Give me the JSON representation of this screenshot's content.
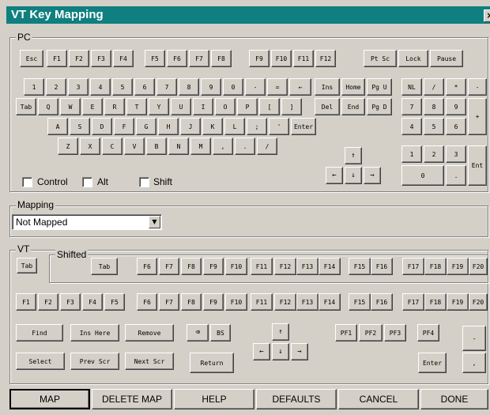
{
  "window": {
    "title": "VT Key Mapping",
    "close_glyph": "×"
  },
  "pc": {
    "group_label": "PC",
    "keys": {
      "esc": "Esc",
      "f1": "F1",
      "f2": "F2",
      "f3": "F3",
      "f4": "F4",
      "f5": "F5",
      "f6": "F6",
      "f7": "F7",
      "f8": "F8",
      "f9": "F9",
      "f10": "F10",
      "f11": "F11",
      "f12": "F12",
      "ptsc": "Pt Sc",
      "lock": "Lock",
      "pause": "Pause",
      "n1": "1",
      "n2": "2",
      "n3": "3",
      "n4": "4",
      "n5": "5",
      "n6": "6",
      "n7": "7",
      "n8": "8",
      "n9": "9",
      "n0": "0",
      "minus": "-",
      "equals": "=",
      "bksp": "←",
      "ins": "Ins",
      "home": "Home",
      "pgu": "Pg U",
      "nl": "NL",
      "kslash": "/",
      "kstar": "*",
      "kminus": "-",
      "tab": "Tab",
      "q": "Q",
      "w": "W",
      "e": "E",
      "r": "R",
      "t": "T",
      "y": "Y",
      "u": "U",
      "i": "I",
      "o": "O",
      "p": "P",
      "lbr": "[",
      "rbr": "]",
      "del": "Del",
      "end": "End",
      "pgd": "Pg D",
      "k7": "7",
      "k8": "8",
      "k9": "9",
      "kplus": "+",
      "a": "A",
      "s": "S",
      "d": "D",
      "f": "F",
      "g": "G",
      "h": "H",
      "j": "J",
      "k": "K",
      "l": "L",
      "semi": ";",
      "quote": "'",
      "enter": "Enter",
      "k4": "4",
      "k5": "5",
      "k6": "6",
      "z": "Z",
      "x": "X",
      "c": "C",
      "v": "V",
      "b": "B",
      "n": "N",
      "m": "M",
      "comma": ",",
      "period": ".",
      "slash": "/",
      "up": "↑",
      "left": "←",
      "down": "↓",
      "right": "→",
      "k1": "1",
      "k2": "2",
      "k3": "3",
      "kent": "Ent",
      "k0": "0",
      "kdot": "."
    },
    "modifiers": {
      "control": "Control",
      "alt": "Alt",
      "shift": "Shift"
    }
  },
  "mapping": {
    "group_label": "Mapping",
    "selected": "Not Mapped"
  },
  "vt": {
    "group_label": "VT",
    "shifted_label": "Shifted",
    "keys": {
      "tab": "Tab",
      "s_tab": "Tab",
      "s_f6": "F6",
      "s_f7": "F7",
      "s_f8": "F8",
      "s_f9": "F9",
      "s_f10": "F10",
      "s_f11": "F11",
      "s_f12": "F12",
      "s_f13": "F13",
      "s_f14": "F14",
      "s_f15": "F15",
      "s_f16": "F16",
      "s_f17": "F17",
      "s_f18": "F18",
      "s_f19": "F19",
      "s_f20": "F20",
      "f1": "F1",
      "f2": "F2",
      "f3": "F3",
      "f4": "F4",
      "f5": "F5",
      "f6": "F6",
      "f7": "F7",
      "f8": "F8",
      "f9": "F9",
      "f10": "F10",
      "f11": "F11",
      "f12": "F12",
      "f13": "F13",
      "f14": "F14",
      "f15": "F15",
      "f16": "F16",
      "f17": "F17",
      "f18": "F18",
      "f19": "F19",
      "f20": "F20",
      "find": "Find",
      "inshere": "Ins Here",
      "remove": "Remove",
      "bsicon": "⌫",
      "bs": "BS",
      "select": "Select",
      "prevscr": "Prev Scr",
      "nextscr": "Next Scr",
      "ret": "Return",
      "up": "↑",
      "left": "←",
      "down": "↓",
      "right": "→",
      "pf1": "PF1",
      "pf2": "PF2",
      "pf3": "PF3",
      "pf4": "PF4",
      "kminus": "-",
      "kenter": "Enter",
      "kcomma": ","
    }
  },
  "buttons": {
    "map": "MAP",
    "delete_map": "DELETE MAP",
    "help": "HELP",
    "defaults": "DEFAULTS",
    "cancel": "CANCEL",
    "done": "DONE"
  },
  "colors": {
    "titlebar": "#0f7f7f",
    "face": "#d4d0c8"
  }
}
